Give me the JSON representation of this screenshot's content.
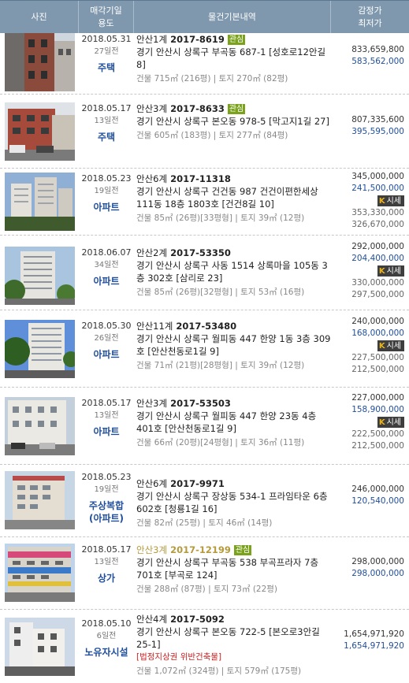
{
  "header": {
    "col_photo": "사진",
    "col_date_line1": "매각기일",
    "col_date_line2": "용도",
    "col_info": "물건기본내역",
    "col_price_line1": "감정가",
    "col_price_line2": "최저가"
  },
  "rows": [
    {
      "date": "2018.05.31",
      "days": "27일전",
      "usage": "주택",
      "usage2": "",
      "court": "안산1계",
      "case_no": "2017-8619",
      "badge": "관심",
      "address": "경기 안산시 상록구 부곡동 687-1 [성호로12안길 8]",
      "warning": "",
      "area": "건물 715㎡ (216평) | 토지 270㎡ (82평)",
      "appraisal": "833,659,800",
      "minimum": "583,562,000",
      "sise": "",
      "extra1": "",
      "extra2": ""
    },
    {
      "date": "2018.05.17",
      "days": "13일전",
      "usage": "주택",
      "usage2": "",
      "court": "안산3계",
      "case_no": "2017-8633",
      "badge": "관심",
      "address": "경기 안산시 상록구 본오동 978-5 [막고지1길 27]",
      "warning": "",
      "area": "건물 605㎡ (183평) | 토지 277㎡ (84평)",
      "appraisal": "807,335,600",
      "minimum": "395,595,000",
      "sise": "",
      "extra1": "",
      "extra2": ""
    },
    {
      "date": "2018.05.23",
      "days": "19일전",
      "usage": "아파트",
      "usage2": "",
      "court": "안산6계",
      "case_no": "2017-11318",
      "badge": "",
      "address": "경기 안산시 상록구 건건동 987 건건이편한세상 111동 18층 1803호 [건건8길 10]",
      "warning": "",
      "area": "건물 85㎡ (26평)[33평형] | 토지 39㎡ (12평)",
      "appraisal": "345,000,000",
      "minimum": "241,500,000",
      "sise": "시세",
      "extra1": "353,330,000",
      "extra2": "326,670,000"
    },
    {
      "date": "2018.06.07",
      "days": "34일전",
      "usage": "아파트",
      "usage2": "",
      "court": "안산2계",
      "case_no": "2017-53350",
      "badge": "",
      "address": "경기 안산시 상록구 사동 1514 상록마을 105동 3층 302호 [삼리로 23]",
      "warning": "",
      "area": "건물 85㎡ (26평)[32평형] | 토지 53㎡ (16평)",
      "appraisal": "292,000,000",
      "minimum": "204,400,000",
      "sise": "시세",
      "extra1": "330,000,000",
      "extra2": "297,500,000"
    },
    {
      "date": "2018.05.30",
      "days": "26일전",
      "usage": "아파트",
      "usage2": "",
      "court": "안산11계",
      "case_no": "2017-53480",
      "badge": "",
      "address": "경기 안산시 상록구 월피동 447 한양 1동 3층 309호 [안산천동로1길 9]",
      "warning": "",
      "area": "건물 71㎡ (21평)[28평형] | 토지 39㎡ (12평)",
      "appraisal": "240,000,000",
      "minimum": "168,000,000",
      "sise": "시세",
      "extra1": "227,500,000",
      "extra2": "212,500,000"
    },
    {
      "date": "2018.05.17",
      "days": "13일전",
      "usage": "아파트",
      "usage2": "",
      "court": "안산3계",
      "case_no": "2017-53503",
      "badge": "",
      "address": "경기 안산시 상록구 월피동 447 한양 23동 4층 401호 [안산천동로1길 9]",
      "warning": "",
      "area": "건물 66㎡ (20평)[24평형] | 토지 36㎡ (11평)",
      "appraisal": "227,000,000",
      "minimum": "158,900,000",
      "sise": "시세",
      "extra1": "222,500,000",
      "extra2": "212,500,000"
    },
    {
      "date": "2018.05.23",
      "days": "19일전",
      "usage": "주상복합",
      "usage2": "(아파트)",
      "court": "안산6계",
      "case_no": "2017-9971",
      "badge": "",
      "address": "경기 안산시 상록구 장상동 534-1 프라임타운 6층 602호 [청룡1길 16]",
      "warning": "",
      "area": "건물 82㎡ (25평) | 토지 46㎡ (14평)",
      "appraisal": "246,000,000",
      "minimum": "120,540,000",
      "sise": "",
      "extra1": "",
      "extra2": ""
    },
    {
      "date": "2018.05.17",
      "days": "13일전",
      "usage": "상가",
      "usage2": "",
      "court": "안산3계",
      "case_no": "2017-12199",
      "badge": "관심",
      "address": "경기 안산시 상록구 부곡동 538 부곡프라자 7층 701호 [부곡로 124]",
      "warning": "",
      "area": "건물 288㎡ (87평) | 토지 73㎡ (22평)",
      "appraisal": "298,000,000",
      "minimum": "298,000,000",
      "sise": "",
      "extra1": "",
      "extra2": ""
    },
    {
      "date": "2018.05.10",
      "days": "6일전",
      "usage": "노유자시설",
      "usage2": "",
      "court": "안산4계",
      "case_no": "2017-5092",
      "badge": "",
      "address": "경기 안산시 상록구 본오동 722-5 [본오로3안길 25-1]",
      "warning": "[법정지상권  위반건축물]",
      "area": "건물 1,072㎡ (324평) | 토지 579㎡ (175평)",
      "appraisal": "1,654,971,920",
      "minimum": "1,654,971,920",
      "sise": "",
      "extra1": "",
      "extra2": ""
    }
  ]
}
